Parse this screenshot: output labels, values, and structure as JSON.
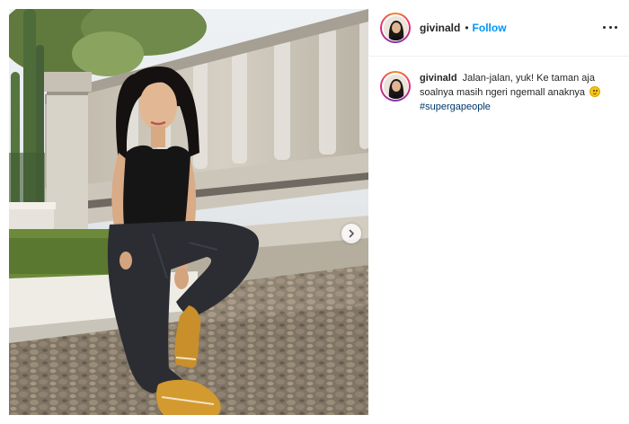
{
  "post": {
    "username": "givinald",
    "separator": "•",
    "follow_label": "Follow",
    "more_icon": "more-options-icon",
    "next_icon": "chevron-right-icon",
    "caption": {
      "username": "givinald",
      "text": "Jalan-jalan, yuk! Ke taman aja soalnya masih ngeri ngemall anaknya",
      "emoji": "slightly-smiling-face",
      "hashtag": "#supergapeople"
    }
  },
  "colors": {
    "follow": "#0095f6",
    "hashtag": "#00376b",
    "text": "#262626",
    "divider": "#efefef"
  }
}
